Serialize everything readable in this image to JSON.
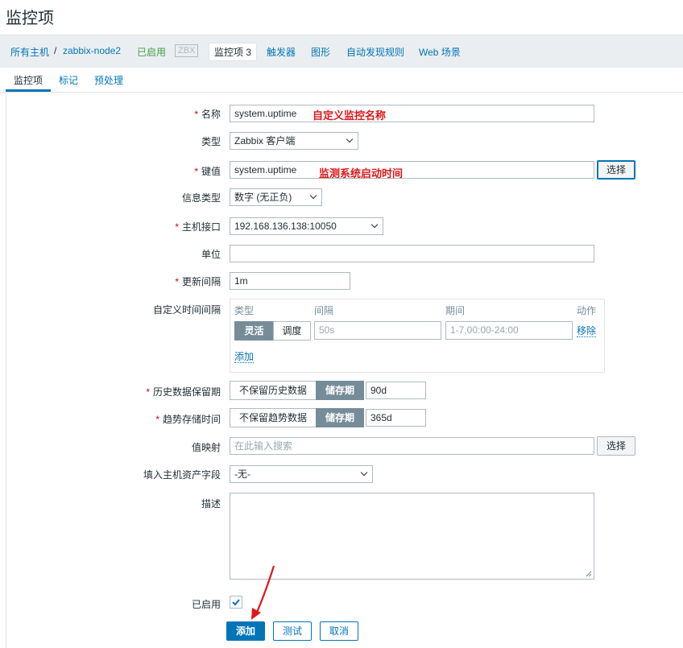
{
  "page": {
    "title": "监控项"
  },
  "breadcrumb": {
    "hosts": "所有主机",
    "sep": "/",
    "host": "zabbix-node2",
    "enabled": "已启用",
    "zbx": "ZBX",
    "items": "监控项 3",
    "triggers": "触发器",
    "graphs": "图形",
    "discovery": "自动发现规则",
    "web": "Web 场景"
  },
  "tabs": [
    "监控项",
    "标记",
    "预处理"
  ],
  "required_mark": "*",
  "form": {
    "name": {
      "label": "名称",
      "value": "system.uptime",
      "annotation": "自定义监控名称"
    },
    "type": {
      "label": "类型",
      "value": "Zabbix 客户端"
    },
    "key": {
      "label": "键值",
      "value": "system.uptime",
      "annotation": "监测系统启动时间",
      "button": "选择"
    },
    "info_type": {
      "label": "信息类型",
      "value": "数字 (无正负)"
    },
    "interface": {
      "label": "主机接口",
      "value": "192.168.136.138:10050"
    },
    "units": {
      "label": "单位",
      "value": ""
    },
    "interval": {
      "label": "更新间隔",
      "value": "1m"
    },
    "custom_intervals": {
      "label": "自定义时间间隔",
      "headers": {
        "type": "类型",
        "interval": "间隔",
        "period": "期间",
        "action": "动作"
      },
      "row": {
        "flexible": "灵活",
        "scheduling": "调度",
        "interval_placeholder": "50s",
        "period_placeholder": "1-7,00:00-24:00",
        "remove": "移除"
      },
      "add": "添加"
    },
    "history": {
      "label": "历史数据保留期",
      "option_off": "不保留历史数据",
      "option_on": "储存期",
      "value": "90d"
    },
    "trends": {
      "label": "趋势存储时间",
      "option_off": "不保留趋势数据",
      "option_on": "储存期",
      "value": "365d"
    },
    "valuemap": {
      "label": "值映射",
      "placeholder": "在此输入搜索",
      "button": "选择"
    },
    "inventory": {
      "label": "填入主机资产字段",
      "value": "-无-"
    },
    "description": {
      "label": "描述",
      "value": ""
    },
    "enabled": {
      "label": "已启用",
      "checked": true
    }
  },
  "actions": {
    "add": "添加",
    "test": "测试",
    "cancel": "取消"
  },
  "colors": {
    "accent": "#0275b8",
    "required": "#d40000",
    "annotation": "#e0171a",
    "enabled_green": "#429e47"
  }
}
